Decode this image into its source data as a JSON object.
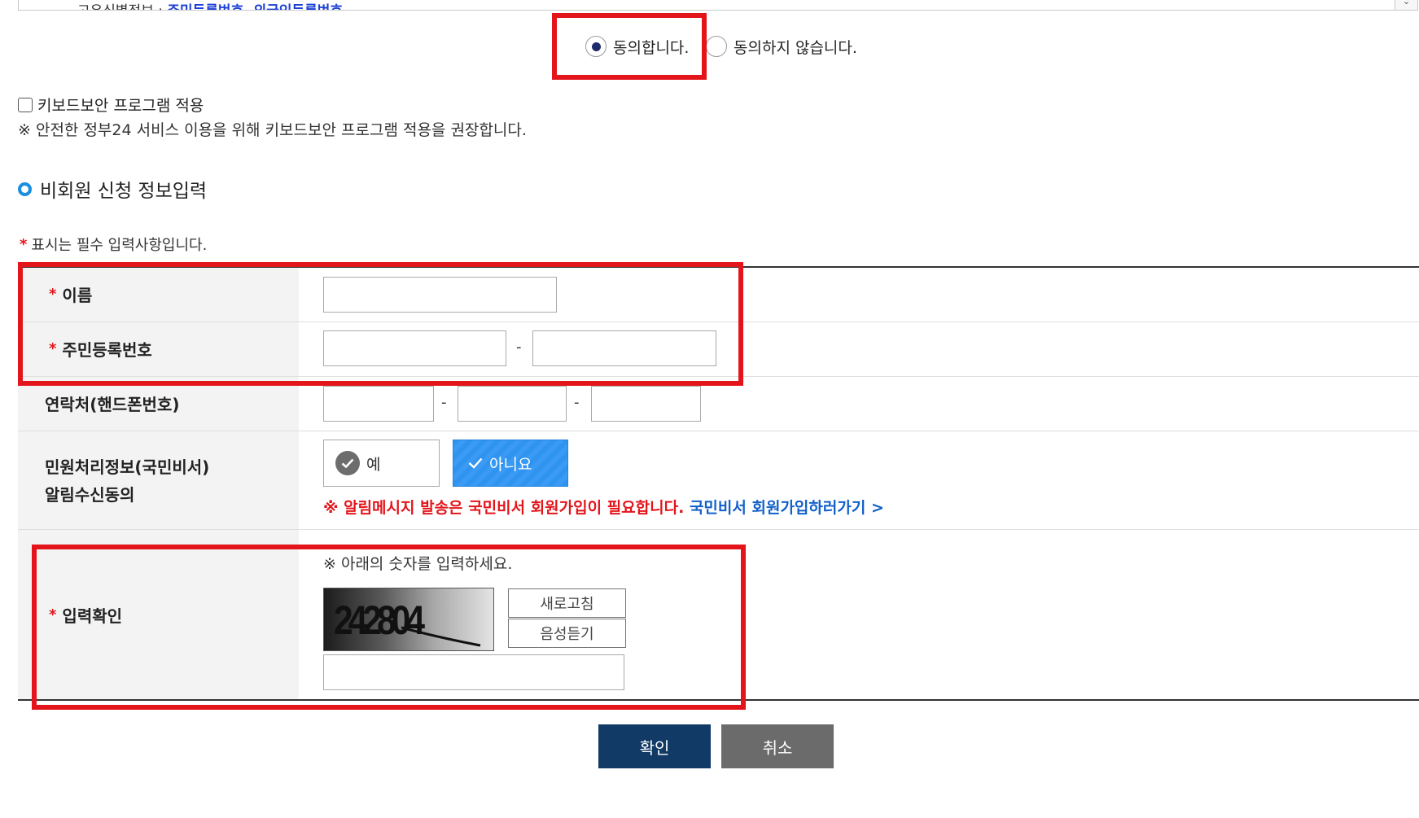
{
  "top_notice": {
    "text_prefix": "고유식별정보 : ",
    "text_link": "주민등록번호, 외국인등록번호",
    "scroll_arrow": "⌄"
  },
  "consent": {
    "agree_label": "동의합니다.",
    "disagree_label": "동의하지 않습니다.",
    "selected": "agree"
  },
  "keyboard_security": {
    "checkbox_label": "키보드보안 프로그램 적용",
    "checked": false,
    "note": "※ 안전한 정부24 서비스 이용을 위해 키보드보안 프로그램 적용을 권장합니다."
  },
  "section": {
    "title": "비회원 신청 정보입력"
  },
  "required_note": {
    "star": "*",
    "text": "표시는 필수 입력사항입니다."
  },
  "form": {
    "name": {
      "label": "이름",
      "value": ""
    },
    "rrn": {
      "label": "주민등록번호",
      "front": "",
      "back": "",
      "separator": "-"
    },
    "phone": {
      "label": "연락처(핸드폰번호)",
      "p1": "",
      "p2": "",
      "p3": "",
      "separator": "-"
    },
    "alarm": {
      "label_line1": "민원처리정보(국민비서)",
      "label_line2": "알림수신동의",
      "yes_label": "예",
      "no_label": "아니요",
      "selected": "no",
      "note_red": "※  알림메시지 발송은 국민비서 회원가입이 필요합니다. ",
      "note_link": "국민비서 회원가입하러가기 >"
    },
    "captcha": {
      "label": "입력확인",
      "note": "※ 아래의 숫자를 입력하세요.",
      "code": "242804",
      "refresh_label": "새로고침",
      "audio_label": "음성듣기",
      "value": ""
    }
  },
  "actions": {
    "confirm_label": "확인",
    "cancel_label": "취소"
  },
  "colors": {
    "highlight_red": "#e3151b",
    "confirm_navy": "#123a66",
    "cancel_gray": "#6b6b6b",
    "toggle_blue": "#2f93f0",
    "link_blue": "#1261c9"
  }
}
